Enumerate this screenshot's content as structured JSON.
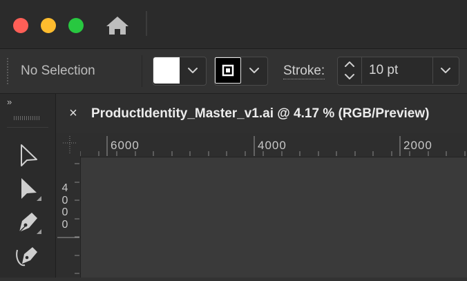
{
  "window": {
    "traffic_lights": {
      "close": "#fe5f57",
      "minimize": "#febc2e",
      "maximize": "#28c840"
    },
    "home_icon": "home-icon"
  },
  "control_bar": {
    "selection_status": "No Selection",
    "fill_color": "#ffffff",
    "stroke_color": "#000000",
    "stroke_label": "Stroke:",
    "stroke_weight": "10 pt"
  },
  "toolbar": {
    "collapse_glyph": "»",
    "tools": [
      {
        "name": "Selection Tool",
        "icon": "selection-arrow-icon"
      },
      {
        "name": "Direct Selection Tool",
        "icon": "direct-selection-arrow-icon"
      },
      {
        "name": "Pen Tool",
        "icon": "pen-icon"
      },
      {
        "name": "Curvature Tool",
        "icon": "curvature-pen-icon"
      }
    ]
  },
  "document": {
    "tab_title": "ProductIdentity_Master_v1.ai @ 4.17 % (RGB/Preview)",
    "close_glyph": "×"
  },
  "rulers": {
    "horizontal_labels": [
      "6000",
      "4000",
      "2000"
    ],
    "vertical_label": "4\n0\n0\n0"
  }
}
